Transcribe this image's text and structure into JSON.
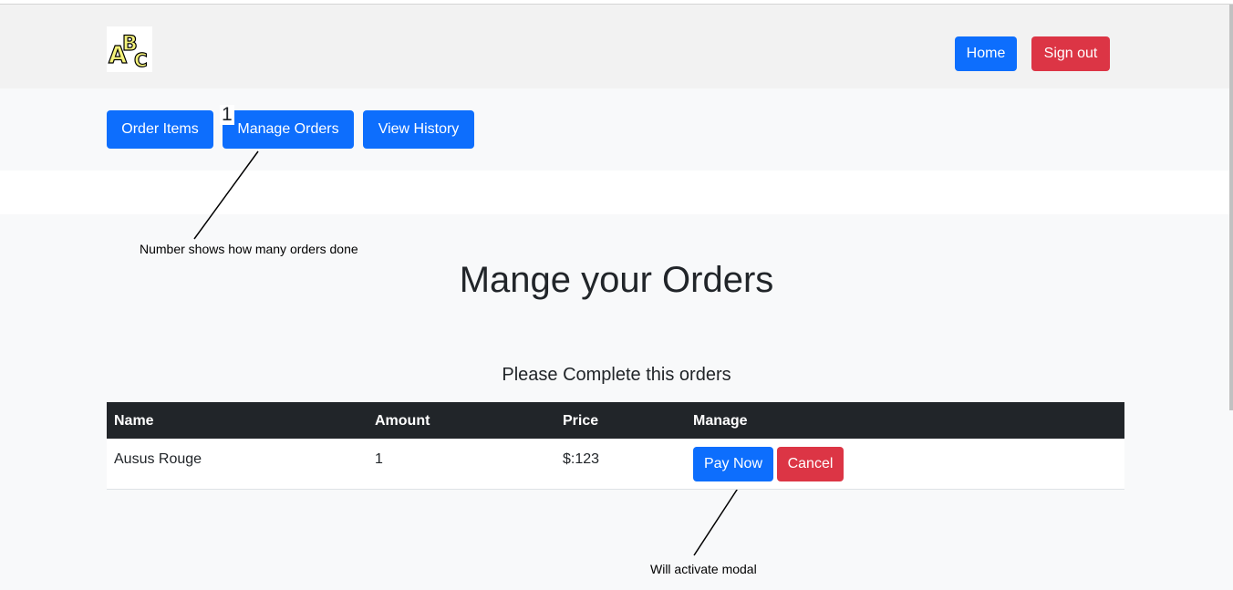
{
  "header": {
    "home_label": "Home",
    "signout_label": "Sign out"
  },
  "nav": {
    "order_items": "Order Items",
    "manage_orders": "Manage Orders",
    "view_history": "View History",
    "orders_count": "1"
  },
  "annotations": {
    "count_note": "Number shows how many orders done",
    "modal_note": "Will activate modal"
  },
  "main": {
    "title": "Mange your Orders",
    "subtitle": "Please Complete this orders"
  },
  "table": {
    "headers": [
      "Name",
      "Amount",
      "Price",
      "Manage"
    ],
    "rows": [
      {
        "name": "Ausus Rouge",
        "amount": "1",
        "price": "$:123",
        "pay_label": "Pay Now",
        "cancel_label": "Cancel"
      }
    ]
  },
  "colors": {
    "primary": "#0d6efd",
    "danger": "#dc3545",
    "table_header": "#212529"
  },
  "icons": {
    "logo": "abc-logo-icon"
  }
}
